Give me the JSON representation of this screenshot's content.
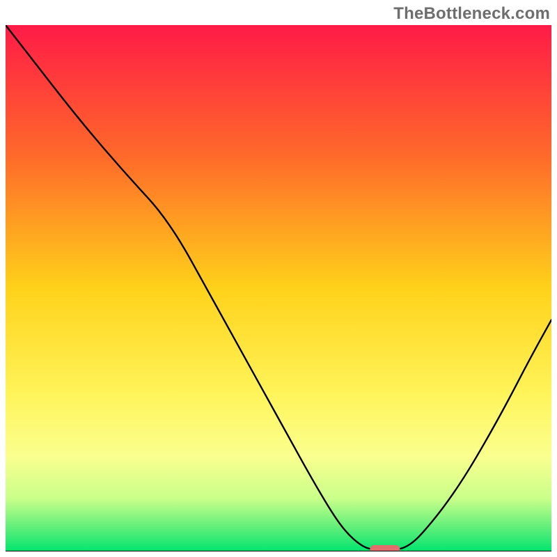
{
  "attribution": "TheBottleneck.com",
  "chart_data": {
    "type": "line",
    "title": "",
    "xlabel": "",
    "ylabel": "",
    "xlim": [
      0,
      100
    ],
    "ylim": [
      0,
      100
    ],
    "background_gradient": {
      "stops": [
        {
          "offset": 0.0,
          "color": "#ff1b47"
        },
        {
          "offset": 0.25,
          "color": "#ff6a2a"
        },
        {
          "offset": 0.5,
          "color": "#ffd21a"
        },
        {
          "offset": 0.7,
          "color": "#fff45a"
        },
        {
          "offset": 0.82,
          "color": "#faff8e"
        },
        {
          "offset": 0.9,
          "color": "#c8ff8a"
        },
        {
          "offset": 0.955,
          "color": "#5fef7a"
        },
        {
          "offset": 1.0,
          "color": "#00e46e"
        }
      ]
    },
    "curve": [
      {
        "x": 0.0,
        "y": 100.0
      },
      {
        "x": 6.0,
        "y": 92.0
      },
      {
        "x": 12.0,
        "y": 84.0
      },
      {
        "x": 18.0,
        "y": 76.5
      },
      {
        "x": 24.0,
        "y": 69.5
      },
      {
        "x": 28.0,
        "y": 65.0
      },
      {
        "x": 32.0,
        "y": 59.0
      },
      {
        "x": 36.0,
        "y": 51.5
      },
      {
        "x": 40.0,
        "y": 44.0
      },
      {
        "x": 44.0,
        "y": 36.5
      },
      {
        "x": 48.0,
        "y": 29.0
      },
      {
        "x": 52.0,
        "y": 21.5
      },
      {
        "x": 56.0,
        "y": 14.0
      },
      {
        "x": 60.0,
        "y": 7.0
      },
      {
        "x": 62.5,
        "y": 3.5
      },
      {
        "x": 65.0,
        "y": 1.2
      },
      {
        "x": 67.0,
        "y": 0.3
      },
      {
        "x": 72.0,
        "y": 0.3
      },
      {
        "x": 74.0,
        "y": 1.2
      },
      {
        "x": 76.0,
        "y": 3.0
      },
      {
        "x": 80.0,
        "y": 8.0
      },
      {
        "x": 84.0,
        "y": 14.0
      },
      {
        "x": 88.0,
        "y": 21.0
      },
      {
        "x": 92.0,
        "y": 28.5
      },
      {
        "x": 96.0,
        "y": 36.5
      },
      {
        "x": 100.0,
        "y": 44.0
      }
    ],
    "marker": {
      "x": 69.5,
      "y": 0.3,
      "width": 5.5,
      "height": 1.8,
      "color": "#e26d6d"
    }
  }
}
